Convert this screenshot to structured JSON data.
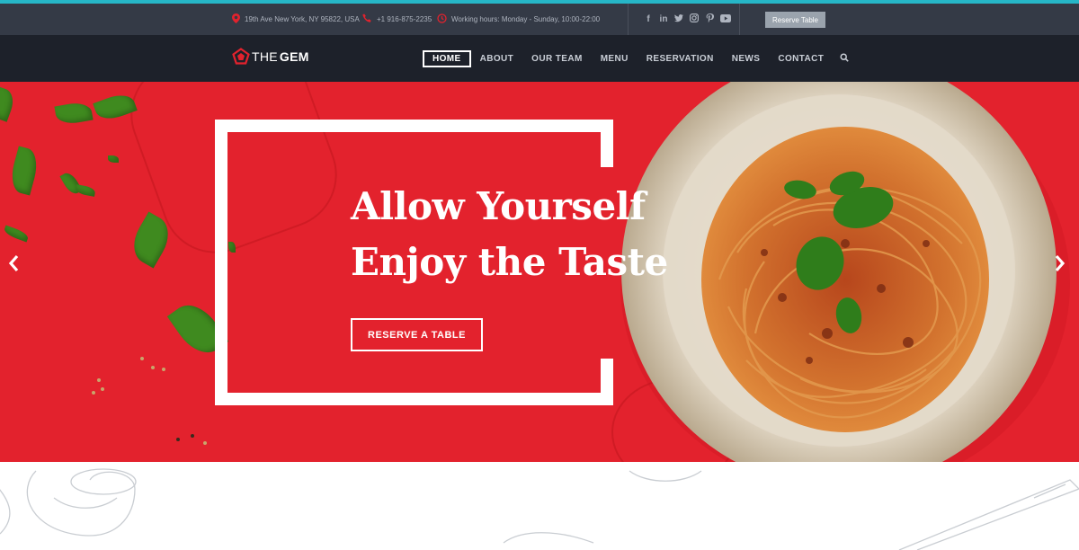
{
  "topbar": {
    "address": "19th Ave New York, NY 95822, USA",
    "phone": "+1 916-875-2235",
    "hours": "Working hours: Monday - Sunday, 10:00-22:00",
    "socials": [
      "facebook-icon",
      "linkedin-icon",
      "twitter-icon",
      "instagram-icon",
      "pinterest-icon",
      "youtube-icon"
    ],
    "reserve_label": "Reserve Table"
  },
  "logo": {
    "part1": "THE",
    "part2": "GEM"
  },
  "nav": {
    "items": [
      "HOME",
      "ABOUT",
      "OUR TEAM",
      "MENU",
      "RESERVATION",
      "NEWS",
      "CONTACT"
    ],
    "active": "HOME"
  },
  "hero": {
    "title_line1": "Allow Yourself",
    "title_line2": "Enjoy the Taste",
    "button_label": "RESERVE A TABLE"
  },
  "colors": {
    "accent": "#26b6c7",
    "brand_red": "#e3222d",
    "topbar_bg": "#343a46",
    "nav_bg": "#1d212a"
  }
}
